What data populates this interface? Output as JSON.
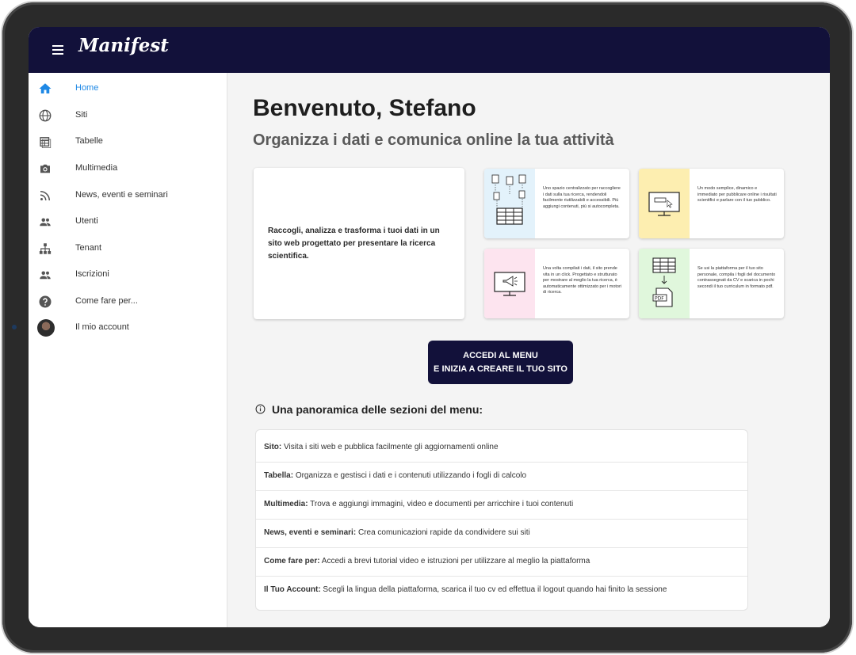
{
  "app": {
    "brand": "Manifest"
  },
  "colors": {
    "appbar": "#12113a",
    "accent": "#1e88e5",
    "cta": "#12113a"
  },
  "sidebar": {
    "items": [
      {
        "label": "Home",
        "icon": "home-icon",
        "active": true
      },
      {
        "label": "Siti",
        "icon": "globe-icon"
      },
      {
        "label": "Tabelle",
        "icon": "table-icon"
      },
      {
        "label": "Multimedia",
        "icon": "camera-icon"
      },
      {
        "label": "News, eventi e seminari",
        "icon": "rss-icon"
      },
      {
        "label": "Utenti",
        "icon": "people-icon"
      },
      {
        "label": "Tenant",
        "icon": "sitemap-icon"
      },
      {
        "label": "Iscrizioni",
        "icon": "people-icon"
      },
      {
        "label": "Come fare per...",
        "icon": "help-icon"
      },
      {
        "label": "Il mio account",
        "icon": "avatar"
      }
    ]
  },
  "main": {
    "title": "Benvenuto, Stefano",
    "subtitle": "Organizza i dati e comunica online la tua attività",
    "intro": "Raccogli, analizza e trasforma i tuoi dati in un sito web progettato per presentare la ricerca scientifica.",
    "cards": [
      {
        "text": "Uno spazio centralizzato per raccogliere i dati sulla tua ricerca, rendendoli facilmente riutilizzabili e accessibili. Più aggiungi contenuti, più si autocompleta.",
        "bg": "#e3f2fb",
        "icon": "documents-table-icon"
      },
      {
        "text": "Un modo semplice, dinamico e immediato per pubblicare online i risultati scientifici e parlare con il tuo pubblico.",
        "bg": "#fdeeb0",
        "icon": "monitor-cursor-icon"
      },
      {
        "text": "Una volta compilati i dati, il sito prende vita in un click. Progettato e strutturato per mostrare al meglio la tua ricerca, è automaticamente ottimizzato per i motori di ricerca.",
        "bg": "#fde4ef",
        "icon": "monitor-megaphone-icon"
      },
      {
        "text": "Se usi la piattaforma per il tuo sito personale, compila i fogli del documento contrassegnati da CV e scarica in pochi secondi il tuo curriculum in formato pdf.",
        "bg": "#e0f7dc",
        "icon": "table-pdf-icon"
      }
    ],
    "cta": {
      "line1": "ACCEDI AL MENU",
      "line2": "E INIZIA A CREARE IL TUO SITO"
    },
    "overview": {
      "title": "Una panoramica delle sezioni del menu:",
      "rows": [
        {
          "key": "Sito:",
          "desc": " Visita i siti web e pubblica facilmente gli aggiornamenti online"
        },
        {
          "key": "Tabella:",
          "desc": " Organizza e gestisci i dati e i contenuti utilizzando i fogli di calcolo"
        },
        {
          "key": "Multimedia:",
          "desc": " Trova e aggiungi immagini, video e documenti per arricchire i tuoi contenuti"
        },
        {
          "key": "News, eventi e seminari:",
          "desc": " Crea comunicazioni rapide da condividere sui siti"
        },
        {
          "key": "Come fare per:",
          "desc": " Accedi a brevi tutorial video e istruzioni per utilizzare al meglio la piattaforma"
        },
        {
          "key": "Il Tuo Account:",
          "desc": " Scegli la lingua della piattaforma, scarica il tuo cv ed effettua il logout quando hai finito la sessione"
        }
      ]
    }
  }
}
